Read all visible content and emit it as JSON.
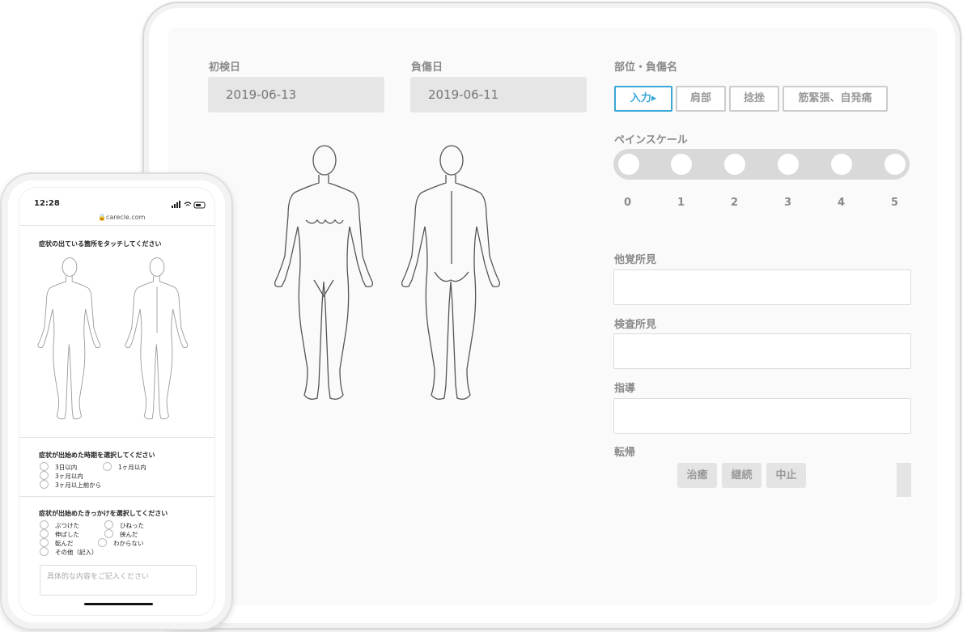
{
  "tablet": {
    "first_visit_label": "初検日",
    "first_visit_value": "2019-06-13",
    "injury_date_label": "負傷日",
    "injury_date_value": "2019-06-11",
    "site_injury_label": "部位・負傷名",
    "chips": [
      "入力▸",
      "肩部",
      "捻挫",
      "筋緊張、自発痛"
    ],
    "pain_scale_label": "ペインスケール",
    "pain_scale_values": [
      "0",
      "1",
      "2",
      "3",
      "4",
      "5"
    ],
    "other_findings_label": "他覚所見",
    "exam_findings_label": "検査所見",
    "guidance_label": "指導",
    "outcome_label": "転帰",
    "outcome_buttons": [
      "治癒",
      "継続",
      "中止"
    ]
  },
  "phone": {
    "time": "12:28",
    "status_icons": "signal-wifi-battery",
    "url": "carecle.com",
    "touch_prompt": "症状の出ている箇所をタッチしてください",
    "onset_prompt": "症状が出始めた時期を選択してください",
    "onset_options": [
      "3日以内",
      "1ヶ月以内",
      "3ヶ月以内",
      "3ヶ月以上前から"
    ],
    "cause_prompt": "症状が出始めたきっかけを選択してください",
    "cause_options": [
      "ぶつけた",
      "ひねった",
      "伸ばした",
      "挟んだ",
      "転んだ",
      "わからない",
      "その他（記入）"
    ],
    "detail_placeholder": "具体的な内容をご記入ください"
  },
  "colors": {
    "accent": "#3aa7d6",
    "track": "#d9d9d9",
    "field": "#e6e6e6"
  }
}
